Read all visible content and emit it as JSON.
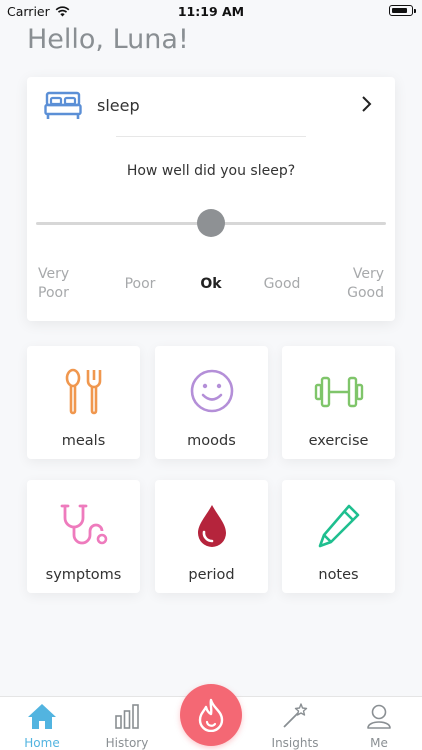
{
  "status_bar": {
    "carrier": "Carrier",
    "time": "11:19 AM"
  },
  "greeting": "Hello, Luna!",
  "sleep": {
    "title": "sleep",
    "question": "How well did you sleep?",
    "scale": [
      "Very Poor",
      "Poor",
      "Ok",
      "Good",
      "Very Good"
    ],
    "selected": "Ok",
    "slider_value": 0.5
  },
  "tiles": [
    {
      "label": "meals",
      "icon": "utensils-icon",
      "color": "#f0974e"
    },
    {
      "label": "moods",
      "icon": "smiley-icon",
      "color": "#b48fd8"
    },
    {
      "label": "exercise",
      "icon": "dumbbell-icon",
      "color": "#7fc56a"
    },
    {
      "label": "symptoms",
      "icon": "stethoscope-icon",
      "color": "#ee7bbd"
    },
    {
      "label": "period",
      "icon": "drop-icon",
      "color": "#b5243c"
    },
    {
      "label": "notes",
      "icon": "pencil-icon",
      "color": "#1fbf8f"
    }
  ],
  "tabs": [
    {
      "label": "Home",
      "icon": "home-icon",
      "active": true
    },
    {
      "label": "History",
      "icon": "bar-chart-icon"
    },
    {
      "label": "Insights",
      "icon": "magic-wand-icon"
    },
    {
      "label": "Me",
      "icon": "person-icon"
    }
  ],
  "colors": {
    "accent": "#52b4e0",
    "fab": "#f46874",
    "sleep_icon": "#5b8fd6"
  },
  "fab_icon": "flame-icon"
}
